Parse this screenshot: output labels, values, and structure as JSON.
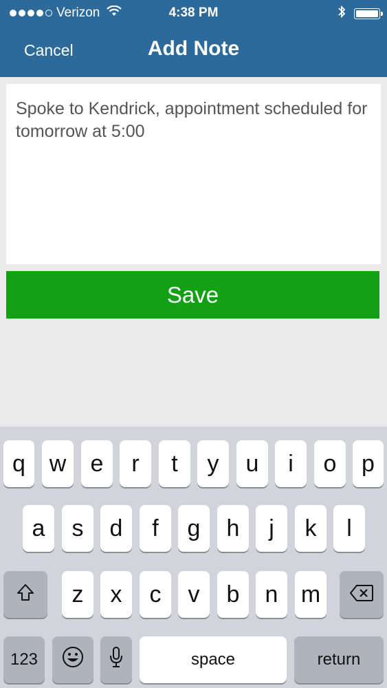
{
  "status_bar": {
    "carrier": "Verizon",
    "time": "4:38 PM",
    "signal_icon": "signal-dots-icon",
    "wifi_icon": "wifi-icon",
    "bluetooth_icon": "bluetooth-icon",
    "battery_icon": "battery-icon"
  },
  "nav": {
    "cancel_label": "Cancel",
    "title": "Add Note"
  },
  "note": {
    "text": "Spoke to Kendrick, appointment scheduled for tomorrow at 5:00"
  },
  "save_label": "Save",
  "colors": {
    "header": "#2d6a9c",
    "save": "#14a014",
    "background": "#ebebec"
  },
  "keyboard": {
    "row1": [
      "q",
      "w",
      "e",
      "r",
      "t",
      "y",
      "u",
      "i",
      "o",
      "p"
    ],
    "row2": [
      "a",
      "s",
      "d",
      "f",
      "g",
      "h",
      "j",
      "k",
      "l"
    ],
    "row3": [
      "z",
      "x",
      "c",
      "v",
      "b",
      "n",
      "m"
    ],
    "numbers_label": "123",
    "space_label": "space",
    "return_label": "return",
    "shift_icon": "shift-icon",
    "delete_icon": "backspace-icon",
    "emoji_icon": "emoji-icon",
    "mic_icon": "microphone-icon"
  }
}
